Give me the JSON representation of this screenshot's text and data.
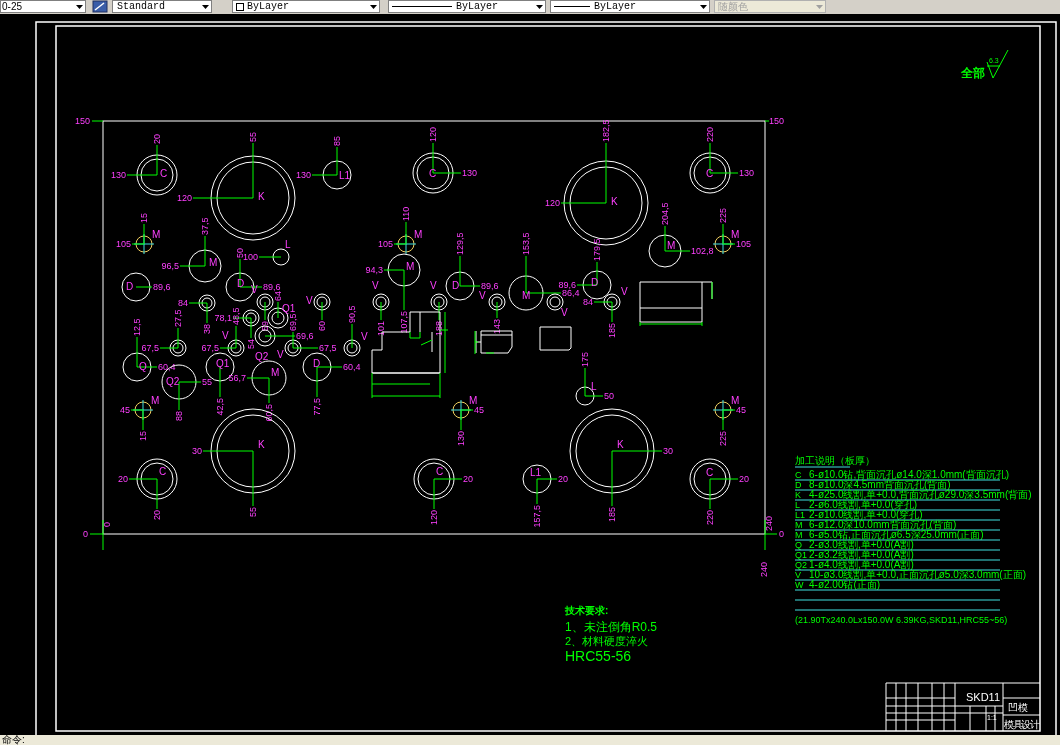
{
  "toolbar": {
    "dimstyle": "0-25",
    "textstyle": "Standard",
    "layer_color": "ByLayer",
    "linetype": "ByLayer",
    "lineweight": "ByLayer",
    "plot_style": {
      "text": "随颜色",
      "disabled": true
    }
  },
  "drawing": {
    "axis_labels": [
      "150",
      "150",
      "0",
      "0",
      "240",
      "0",
      "240"
    ],
    "holes": [
      {
        "label": "C",
        "x_dim": "20",
        "y_dim": "130"
      },
      {
        "label": "K",
        "x_dim": "55",
        "y_dim": "120"
      },
      {
        "label": "L1",
        "x_dim": "85",
        "y_dim": "130"
      },
      {
        "label": "C",
        "x_dim": "120",
        "y_dim": "130"
      },
      {
        "label": "K",
        "x_dim": "182,5",
        "y_dim": "120"
      },
      {
        "label": "C",
        "x_dim": "220",
        "y_dim": "130"
      },
      {
        "label": "M",
        "x_dim": "15",
        "y_dim": "105"
      },
      {
        "label": "M",
        "x_dim": "37,5",
        "y_dim": "96,5"
      },
      {
        "label": "L",
        "y_dim": "100"
      },
      {
        "label": "D",
        "y_dim": "89,6"
      },
      {
        "label": "D",
        "x_dim": "50",
        "y_dim": "89,6"
      },
      {
        "label": "M",
        "x_dim": "110",
        "y_dim": "105"
      },
      {
        "label": "M",
        "x_dim": "107,5",
        "y_dim": "94,3"
      },
      {
        "label": "D",
        "x_dim": "129,5",
        "y_dim": "89,6"
      },
      {
        "label": "D",
        "x_dim": "179,5",
        "y_dim": "89,6"
      },
      {
        "label": "M",
        "x_dim": "153,5",
        "y_dim": "86,4"
      },
      {
        "label": "M",
        "x_dim": "204,5",
        "y_dim": "102,8"
      },
      {
        "label": "M",
        "x_dim": "225",
        "y_dim": "105"
      },
      {
        "x_dim": "38",
        "y_dim": "84"
      },
      {
        "label": "V",
        "x_dim": "59"
      },
      {
        "x_dim": "54",
        "y_dim": "78,1"
      },
      {
        "label": "Q1",
        "x_dim": "64"
      },
      {
        "label": "V",
        "x_dim": "60"
      },
      {
        "x_dim": "27,5",
        "y_dim": "67,5"
      },
      {
        "label": "V",
        "x_dim": "48,5",
        "y_dim": "67,5"
      },
      {
        "label": "Q2",
        "y_dim": "69,6"
      },
      {
        "label": "V",
        "x_dim": "69,5",
        "y_dim": "67,5"
      },
      {
        "label": "V",
        "x_dim": "90,5"
      },
      {
        "label": "Q",
        "x_dim": "12,5",
        "y_dim": "60,4"
      },
      {
        "label": "Q2",
        "x_dim": "88",
        "y_dim": "55"
      },
      {
        "label": "Q1",
        "x_dim": "42,5"
      },
      {
        "label": "M",
        "x_dim": "60,5",
        "y_dim": "56,7"
      },
      {
        "label": "D",
        "x_dim": "77,5",
        "y_dim": "60,4"
      },
      {
        "label": "M",
        "x_dim": "15",
        "y_dim": "45"
      },
      {
        "label": "V",
        "x_dim": "101"
      },
      {
        "label": "V",
        "x_dim": "188"
      },
      {
        "label": "V",
        "x_dim": "143"
      },
      {
        "label": "V"
      },
      {
        "label": "V",
        "x_dim": "185",
        "y_dim": "84"
      },
      {
        "label": "L",
        "x_dim": "175",
        "y_dim": "50"
      },
      {
        "label": "M",
        "x_dim": "130",
        "y_dim": "45"
      },
      {
        "label": "M",
        "x_dim": "225",
        "y_dim": "45"
      },
      {
        "label": "K",
        "x_dim": "55",
        "y_dim": "30"
      },
      {
        "label": "C",
        "x_dim": "20",
        "y_dim": "20"
      },
      {
        "label": "C",
        "x_dim": "120",
        "y_dim": "20"
      },
      {
        "label": "L1",
        "x_dim": "157,5",
        "y_dim": "20"
      },
      {
        "label": "K",
        "x_dim": "185",
        "y_dim": "30"
      },
      {
        "label": "C",
        "x_dim": "220",
        "y_dim": "20"
      }
    ],
    "finish": {
      "label": "全部",
      "value": "6.3"
    },
    "process_table": {
      "title": "加工说明（板厚）",
      "rows": [
        {
          "code": "C",
          "text": "6-ø10.0钻,背面沉孔ø14.0深1.0mm(背面沉孔)"
        },
        {
          "code": "D",
          "text": "8-ø10.0深4.5mm背面沉孔(背面)"
        },
        {
          "code": "K",
          "text": "4-ø25.0线割,单+0.0,背面沉孔ø29.0深3.5mm(背面)"
        },
        {
          "code": "L",
          "text": "2-ø6.0线割,单+0.0(穿孔)"
        },
        {
          "code": "L1",
          "text": "2-ø10.0线割,单+0.0(穿孔)"
        },
        {
          "code": "M",
          "text": "6-ø12.0深10.0mm背面沉孔(背面)"
        },
        {
          "code": "M",
          "text": "6-ø5.0钻,正面沉孔ø6.5深25.0mm(正面)"
        },
        {
          "code": "Q",
          "text": "2-ø3.0线割,单+0.0(A割)"
        },
        {
          "code": "Q1",
          "text": "2-ø3.2线割,单+0.0(A割)"
        },
        {
          "code": "Q2",
          "text": "1-ø4.0线割,单+0.0(A割)"
        },
        {
          "code": "V",
          "text": "10-ø3.0线割,单+0.0,正面沉孔ø5.0深3.0mm(正面)"
        },
        {
          "code": "W",
          "text": "4-ø2.00钻(正面)"
        }
      ],
      "summary": "(21.90Tx240.0Lx150.0W 6.39KG,SKD11,HRC55~56)"
    },
    "notes": {
      "title": "技术要求:",
      "lines": [
        "1、未注倒角R0.5",
        "2、材料硬度淬火",
        "HRC55-56"
      ]
    },
    "title_block": {
      "material": "SKD11",
      "part_name": "凹模",
      "scale": "1:1",
      "designer": "模具设计"
    }
  },
  "command_line": {
    "prompt": "命令:"
  }
}
